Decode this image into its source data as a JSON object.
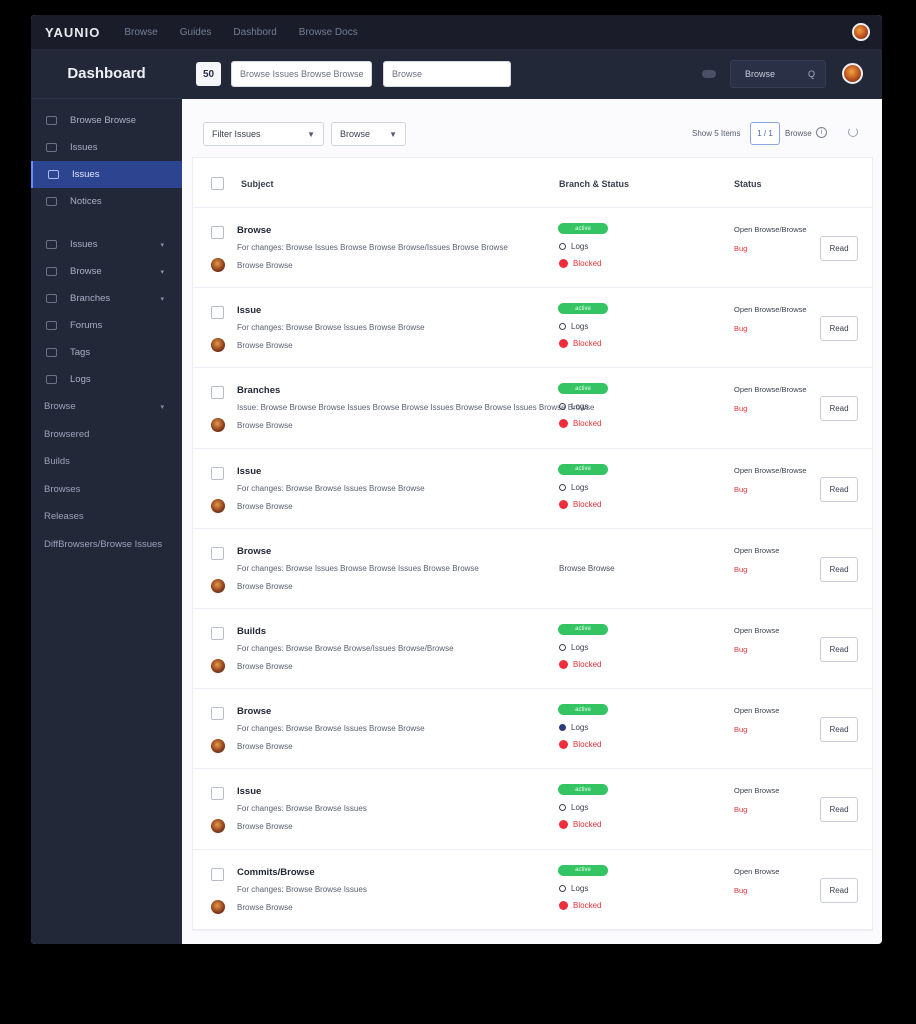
{
  "app": {
    "brand": "YAUNIO",
    "topnav": [
      "Browse",
      "Guides",
      "Dashbord",
      "Browse Docs"
    ]
  },
  "sidebar": {
    "title": "Dashboard",
    "items": [
      {
        "label": "Browse Browse"
      },
      {
        "label": "Issues"
      },
      {
        "label": "Issues",
        "active": true
      },
      {
        "label": "Notices"
      }
    ],
    "items2": [
      {
        "label": "Issues",
        "arrow": "▾"
      },
      {
        "label": "Browse",
        "arrow": "▾"
      },
      {
        "label": "Branches",
        "arrow": "▾"
      },
      {
        "label": "Forums"
      },
      {
        "label": "Tags"
      },
      {
        "label": "Logs"
      }
    ],
    "text_items": [
      {
        "label": "Browse",
        "arrow": "▾"
      },
      {
        "label": "Browsered"
      },
      {
        "label": "Builds"
      },
      {
        "label": "Browses"
      },
      {
        "label": "Releases"
      },
      {
        "label": "DiffBrowsers/Browse Issues"
      }
    ]
  },
  "header": {
    "button_label": "50",
    "input_a_placeholder": "Browse Issues Browse Browse",
    "input_b_placeholder": "Browse",
    "select_label": "Browse",
    "select_caret": "Q"
  },
  "filters": {
    "dropdown_a": "Filter Issues",
    "dropdown_b": "Browse",
    "pager_label": "Show 5 Items",
    "pager_value": "1 / 1",
    "pager_next": "Browse",
    "info_glyph": "i"
  },
  "table": {
    "columns": [
      "Subject",
      "Branch & Status",
      "Status"
    ],
    "action_label": "Read",
    "rows": [
      {
        "title": "Browse",
        "desc": "For changes: Browse Issues Browse Browse Browse/Issues Browse Browse",
        "author": "Browse Browse",
        "pill": "active",
        "status1": "Logs",
        "status2": "Blocked",
        "meta": "Open Browse/Browse",
        "meta_red": "Bug"
      },
      {
        "title": "Issue",
        "desc": "For changes: Browse Browse Issues Browse Browse",
        "author": "Browse Browse",
        "pill": "active",
        "status1": "Logs",
        "status2": "Blocked",
        "meta": "Open Browse/Browse",
        "meta_red": "Bug"
      },
      {
        "title": "Branches",
        "desc": "Issue: Browse Browse Browse Issues Browse Browse Issues Browse Browse Issues Browse Browse",
        "author": "Browse Browse",
        "pill": "active",
        "status1": "Logs",
        "status2": "Blocked",
        "meta": "Open Browse/Browse",
        "meta_red": "Bug"
      },
      {
        "title": "Issue",
        "desc": "For changes: Browse Browse Issues Browse Browse",
        "author": "Browse Browse",
        "pill": "active",
        "status1": "Logs",
        "status2": "Blocked",
        "meta": "Open Browse/Browse",
        "meta_red": "Bug"
      },
      {
        "title": "Browse",
        "desc": "For changes: Browse Issues Browse Browse Issues Browse Browse",
        "author": "Browse Browse",
        "pill": "",
        "status1": "",
        "status2": "",
        "plain": "Browse Browse",
        "meta": "Open Browse",
        "meta_red": "Bug"
      },
      {
        "title": "Builds",
        "desc": "For changes: Browse Browse Browse/Issues Browse/Browse",
        "author": "Browse Browse",
        "pill": "active",
        "status1": "Logs",
        "status2": "Blocked",
        "meta": "Open Browse",
        "meta_red": "Bug"
      },
      {
        "title": "Browse",
        "desc": "For changes: Browse Browse Issues Browse Browse",
        "author": "Browse Browse",
        "pill": "active",
        "status1": "Logs",
        "status2": "Blocked",
        "dot_blue": true,
        "meta": "Open Browse",
        "meta_red": "Bug"
      },
      {
        "title": "Issue",
        "desc": "For changes: Browse Browse Issues",
        "author": "Browse Browse",
        "pill": "active",
        "status1": "Logs",
        "status2": "Blocked",
        "meta": "Open Browse",
        "meta_red": "Bug"
      },
      {
        "title": "Commits/Browse",
        "desc": "For changes: Browse Browse Issues",
        "author": "Browse Browse",
        "pill": "active",
        "status1": "Logs",
        "status2": "Blocked",
        "meta": "Open Browse",
        "meta_red": "Bug"
      }
    ]
  },
  "colors": {
    "sidebar_bg": "#232839",
    "accent_active": "#2d4491",
    "pill_green": "#34c463",
    "status_red": "#ee2e3a"
  }
}
